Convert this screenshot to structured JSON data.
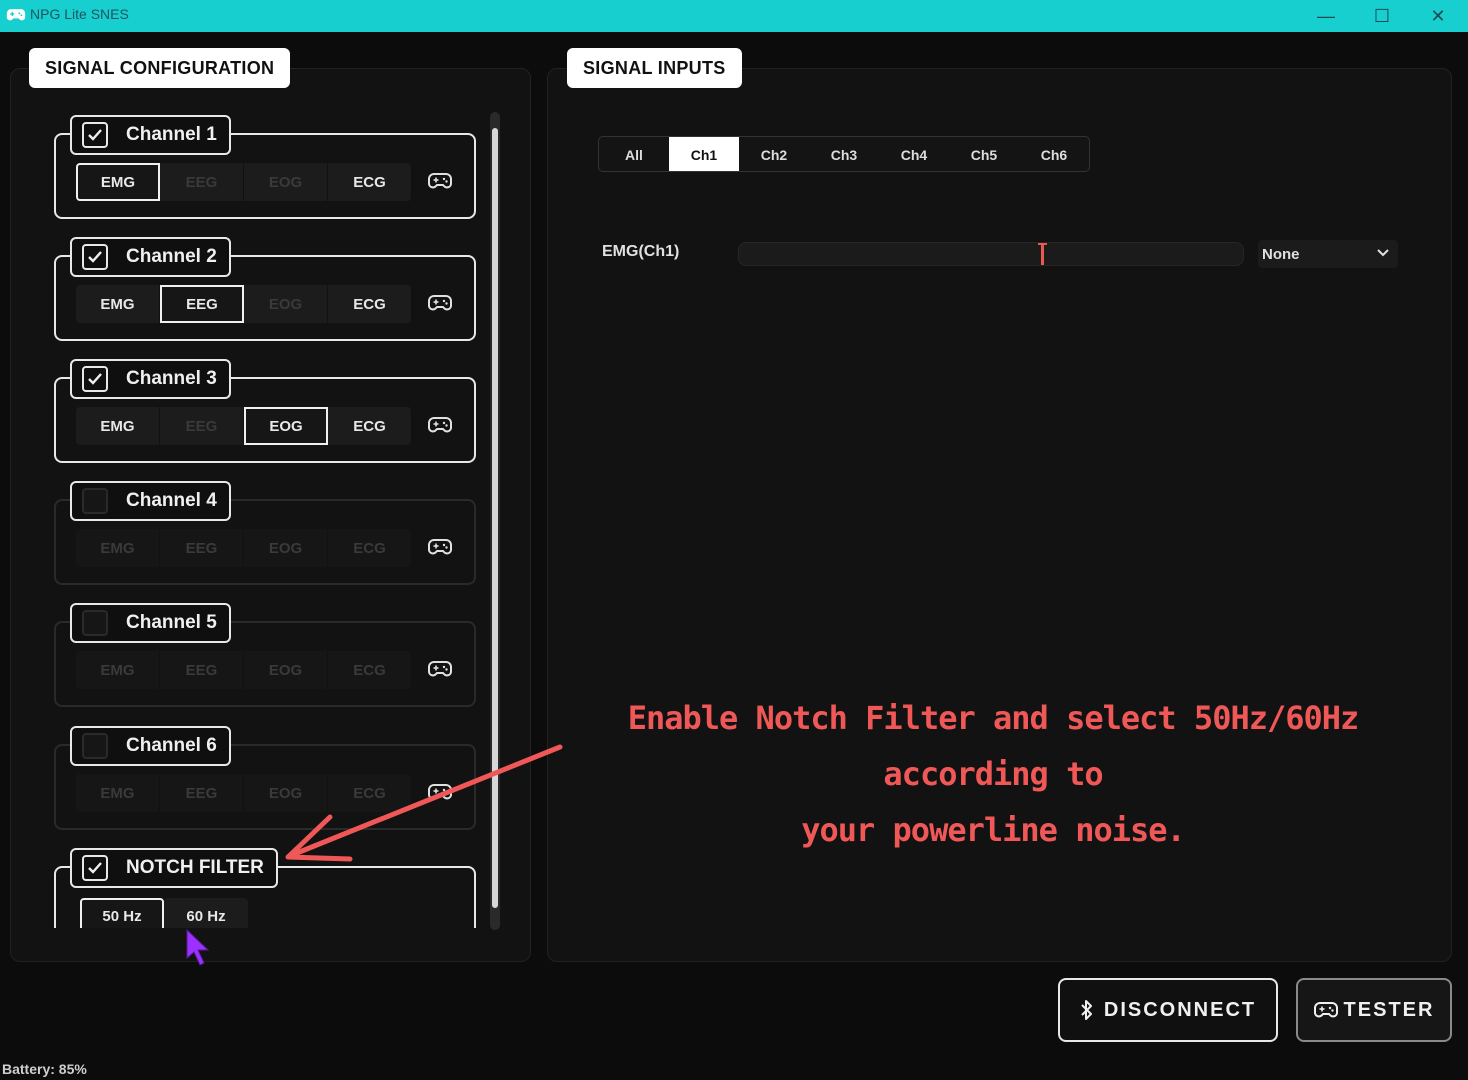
{
  "window": {
    "title": "NPG Lite SNES",
    "minimize_glyph": "—",
    "maximize_glyph": "☐",
    "close_glyph": "✕"
  },
  "signal_configuration": {
    "label": "SIGNAL CONFIGURATION",
    "channels": [
      {
        "name": "Channel 1",
        "enabled": true,
        "options": [
          "EMG",
          "EEG",
          "EOG",
          "ECG"
        ],
        "selected": "EMG"
      },
      {
        "name": "Channel 2",
        "enabled": true,
        "options": [
          "EMG",
          "EEG",
          "EOG",
          "ECG"
        ],
        "selected": "EEG"
      },
      {
        "name": "Channel 3",
        "enabled": true,
        "options": [
          "EMG",
          "EEG",
          "EOG",
          "ECG"
        ],
        "selected": "EOG"
      },
      {
        "name": "Channel 4",
        "enabled": false,
        "options": [
          "EMG",
          "EEG",
          "EOG",
          "ECG"
        ],
        "selected": ""
      },
      {
        "name": "Channel 5",
        "enabled": false,
        "options": [
          "EMG",
          "EEG",
          "EOG",
          "ECG"
        ],
        "selected": ""
      },
      {
        "name": "Channel 6",
        "enabled": false,
        "options": [
          "EMG",
          "EEG",
          "EOG",
          "ECG"
        ],
        "selected": ""
      }
    ],
    "notch_filter": {
      "label": "NOTCH FILTER",
      "enabled": true,
      "options": [
        "50 Hz",
        "60 Hz"
      ],
      "selected": "50 Hz"
    }
  },
  "signal_inputs": {
    "label": "SIGNAL INPUTS",
    "tabs": [
      "All",
      "Ch1",
      "Ch2",
      "Ch3",
      "Ch4",
      "Ch5",
      "Ch6"
    ],
    "active_tab": "Ch1",
    "signal_label": "EMG(Ch1)",
    "signal_level": 0.6,
    "mapping_select": "None"
  },
  "annotation": {
    "line1": "Enable Notch Filter and select 50Hz/60Hz according to",
    "line2": "your powerline noise.",
    "color": "#f05858"
  },
  "buttons": {
    "disconnect": "DISCONNECT",
    "tester": "TESTER"
  },
  "status": {
    "battery": "Battery: 85%"
  },
  "colors": {
    "titlebar": "#17cfcf",
    "accent_marker": "#e85a4f",
    "cursor": "#9b30ff"
  }
}
